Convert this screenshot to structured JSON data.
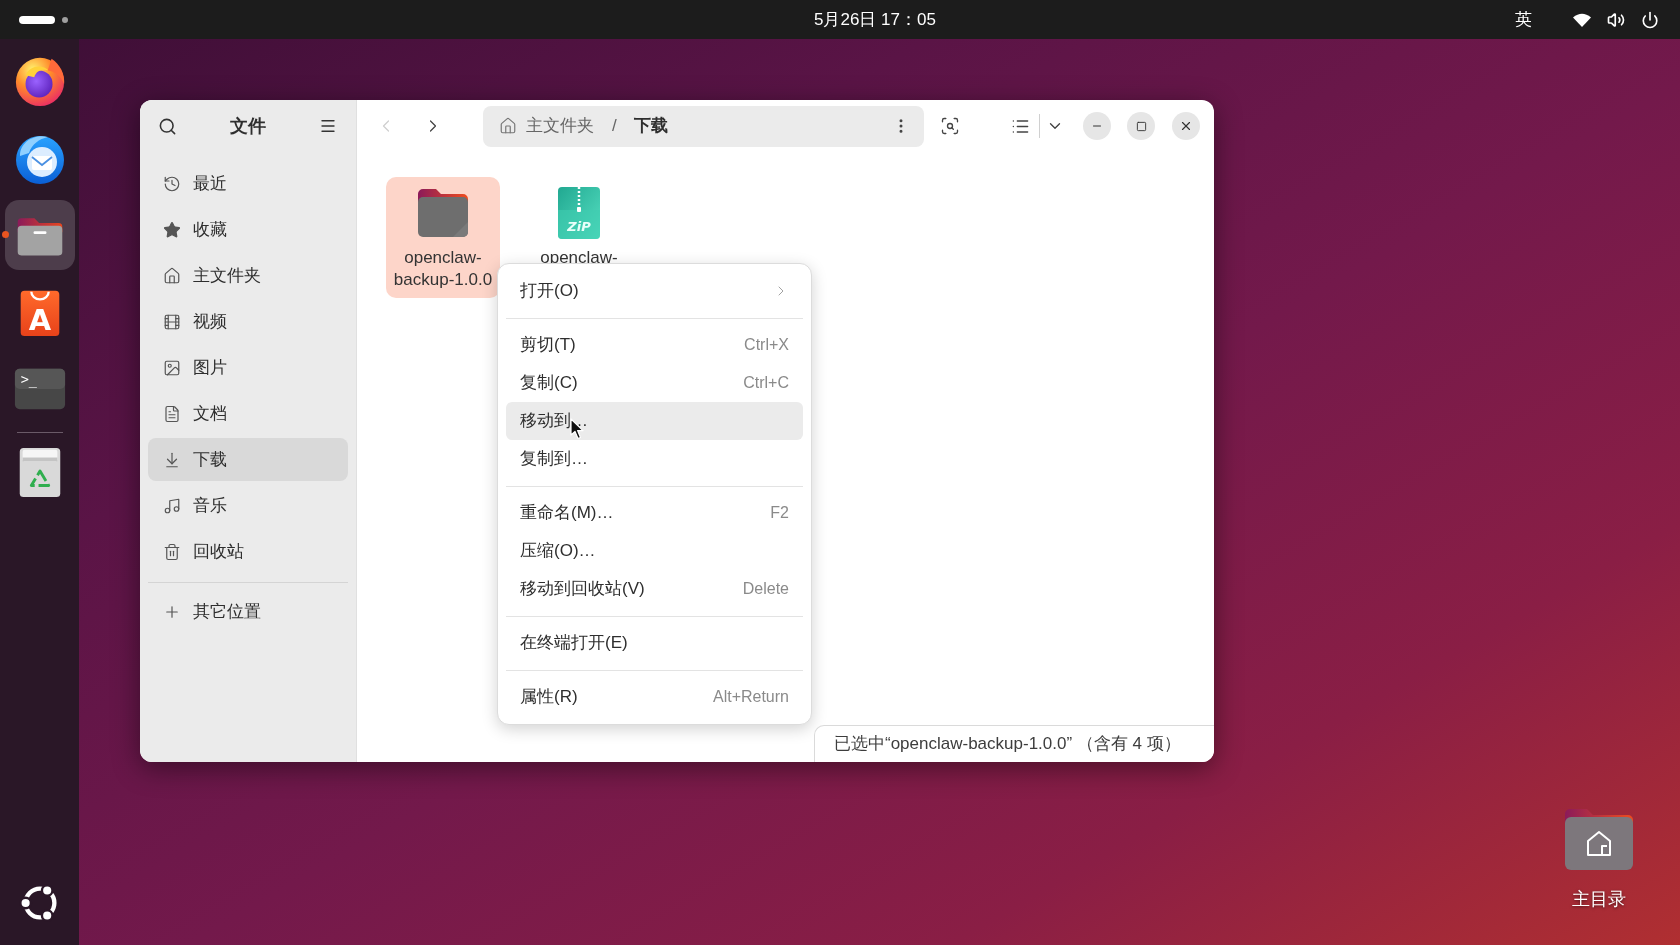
{
  "top_bar": {
    "clock": "5月26日 17：05",
    "input_method": "英"
  },
  "dock": {
    "apps": [
      {
        "kind": "browser",
        "selected": false,
        "running": false
      },
      {
        "kind": "mail",
        "selected": false,
        "running": false
      },
      {
        "kind": "files",
        "selected": true,
        "running": true
      },
      {
        "kind": "store",
        "icon_text": "A",
        "selected": false,
        "running": false
      },
      {
        "kind": "terminal",
        "icon_text": ">_",
        "selected": false,
        "running": false
      }
    ],
    "trash": {
      "kind": "trash",
      "selected": false,
      "running": false
    }
  },
  "files_window": {
    "sidebar": {
      "title": "文件",
      "places": [
        {
          "kind": "recent",
          "label": "最近",
          "selected": false
        },
        {
          "kind": "starred",
          "label": "收藏",
          "selected": false
        },
        {
          "kind": "home",
          "label": "主文件夹",
          "selected": false
        },
        {
          "kind": "videos",
          "label": "视频",
          "selected": false
        },
        {
          "kind": "pictures",
          "label": "图片",
          "selected": false
        },
        {
          "kind": "documents",
          "label": "文档",
          "selected": false
        },
        {
          "kind": "downloads",
          "label": "下载",
          "selected": true
        },
        {
          "kind": "music",
          "label": "音乐",
          "selected": false
        },
        {
          "kind": "trash",
          "label": "回收站",
          "selected": false
        }
      ],
      "other_locations": "其它位置"
    },
    "toolbar": {
      "back": {
        "disabled": true
      },
      "forward": {
        "disabled": false
      },
      "path": [
        {
          "kind": "home",
          "label": "主文件夹",
          "selected": false
        },
        {
          "kind": "folder",
          "label": "下载",
          "selected": true
        }
      ],
      "path_separator": "/"
    },
    "files": [
      {
        "kind": "folder",
        "name": "openclaw-backup-1.0.0",
        "selected": true
      },
      {
        "kind": "archive",
        "name": "openclaw-",
        "icon_text": "ZiP",
        "selected": false
      }
    ],
    "context_menu": {
      "sections": [
        {
          "items": [
            {
              "label": "打开(O)",
              "submenu": true,
              "highlighted": false
            }
          ]
        },
        {
          "items": [
            {
              "label": "剪切(T)",
              "shortcut": "Ctrl+X",
              "submenu": false,
              "highlighted": false
            },
            {
              "label": "复制(C)",
              "shortcut": "Ctrl+C",
              "submenu": false,
              "highlighted": false
            },
            {
              "label": "移动到…",
              "submenu": false,
              "highlighted": true
            },
            {
              "label": "复制到…",
              "submenu": false,
              "highlighted": false
            }
          ]
        },
        {
          "items": [
            {
              "label": "重命名(M)…",
              "shortcut": "F2",
              "submenu": false,
              "highlighted": false
            },
            {
              "label": "压缩(O)…",
              "submenu": false,
              "highlighted": false
            },
            {
              "label": "移动到回收站(V)",
              "shortcut": "Delete",
              "submenu": false,
              "highlighted": false
            }
          ]
        },
        {
          "items": [
            {
              "label": "在终端打开(E)",
              "submenu": false,
              "highlighted": false
            }
          ]
        },
        {
          "items": [
            {
              "label": "属性(R)",
              "shortcut": "Alt+Return",
              "submenu": false,
              "highlighted": false
            }
          ]
        }
      ]
    },
    "status": "已选中“openclaw-backup-1.0.0” （含有 4 项）"
  },
  "desktop_icons": [
    {
      "kind": "home",
      "label": "主目录"
    }
  ]
}
